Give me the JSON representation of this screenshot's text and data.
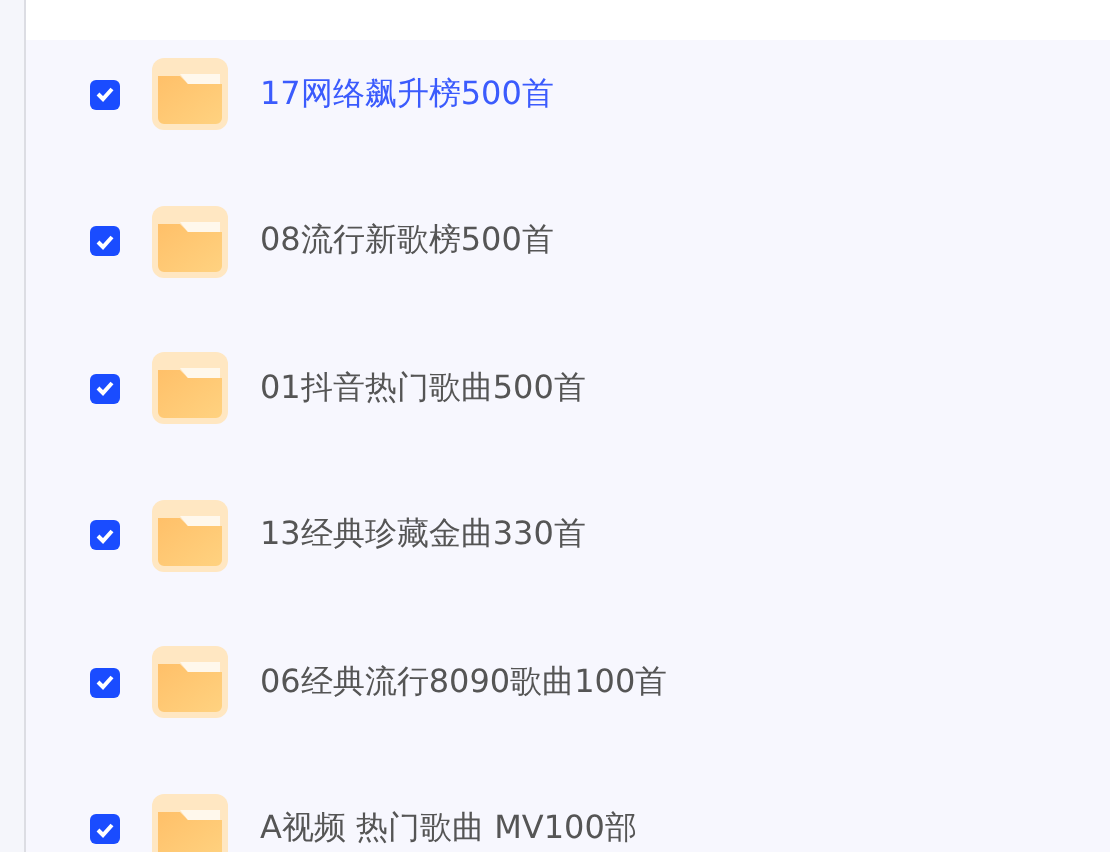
{
  "files": [
    {
      "name": "17网络飙升榜500首",
      "checked": true,
      "selected": true
    },
    {
      "name": "08流行新歌榜500首",
      "checked": true,
      "selected": false
    },
    {
      "name": "01抖音热门歌曲500首",
      "checked": true,
      "selected": false
    },
    {
      "name": "13经典珍藏金曲330首",
      "checked": true,
      "selected": false
    },
    {
      "name": "06经典流行8090歌曲100首",
      "checked": true,
      "selected": false
    },
    {
      "name": "A视频 热门歌曲 MV100部",
      "checked": true,
      "selected": false
    }
  ]
}
